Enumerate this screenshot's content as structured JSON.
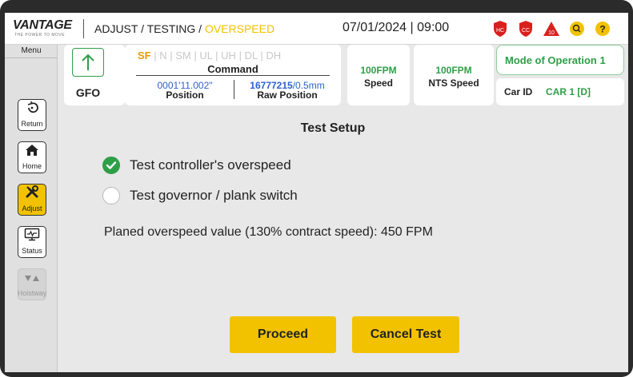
{
  "header": {
    "logo_text": "VANTAGE",
    "logo_tagline": "THE POWER TO MOVE",
    "breadcrumb_prefix": "ADJUST / TESTING / ",
    "breadcrumb_active": "OVERSPEED",
    "date": "07/01/2024",
    "separator": "|",
    "time": "09:00",
    "icons": [
      {
        "name": "hc-alert-icon",
        "label": "HC"
      },
      {
        "name": "cc-alert-icon",
        "label": "CC"
      },
      {
        "name": "warning-icon",
        "label": "10"
      },
      {
        "name": "search-icon",
        "label": ""
      },
      {
        "name": "help-icon",
        "label": "?"
      }
    ]
  },
  "sidebar": {
    "menu_label": "Menu",
    "items": [
      {
        "label": "Return"
      },
      {
        "label": "Home"
      },
      {
        "label": "Adjust"
      },
      {
        "label": "Status"
      },
      {
        "label": "Hoistway"
      }
    ]
  },
  "status": {
    "direction_label": "GFO",
    "modes": [
      "SF",
      "N",
      "SM",
      "UL",
      "UH",
      "DL",
      "DH"
    ],
    "active_mode": "SF",
    "command_label": "Command",
    "position_value": "0001'11.002\"",
    "position_label": "Position",
    "raw_position_strong": "16777215",
    "raw_position_rest": "/0.5mm",
    "raw_position_label": "Raw Position",
    "speed_value": "100FPM",
    "speed_label": "Speed",
    "nts_speed_value": "100FPM",
    "nts_speed_label": "NTS Speed",
    "mode_of_operation": "Mode of Operation 1",
    "car_id_label": "Car ID",
    "car_id_value": "CAR 1 [D]"
  },
  "main": {
    "title": "Test Setup",
    "options": [
      {
        "label": "Test controller's overspeed",
        "checked": true
      },
      {
        "label": "Test governor / plank switch",
        "checked": false
      }
    ],
    "planned_text": "Planed overspeed value (130% contract speed): 450 FPM",
    "proceed_label": "Proceed",
    "cancel_label": "Cancel Test"
  },
  "colors": {
    "accent_yellow": "#f2c200",
    "active_green": "#2e9f47",
    "value_blue": "#2f5fcf",
    "alert_red": "#d9201e"
  }
}
